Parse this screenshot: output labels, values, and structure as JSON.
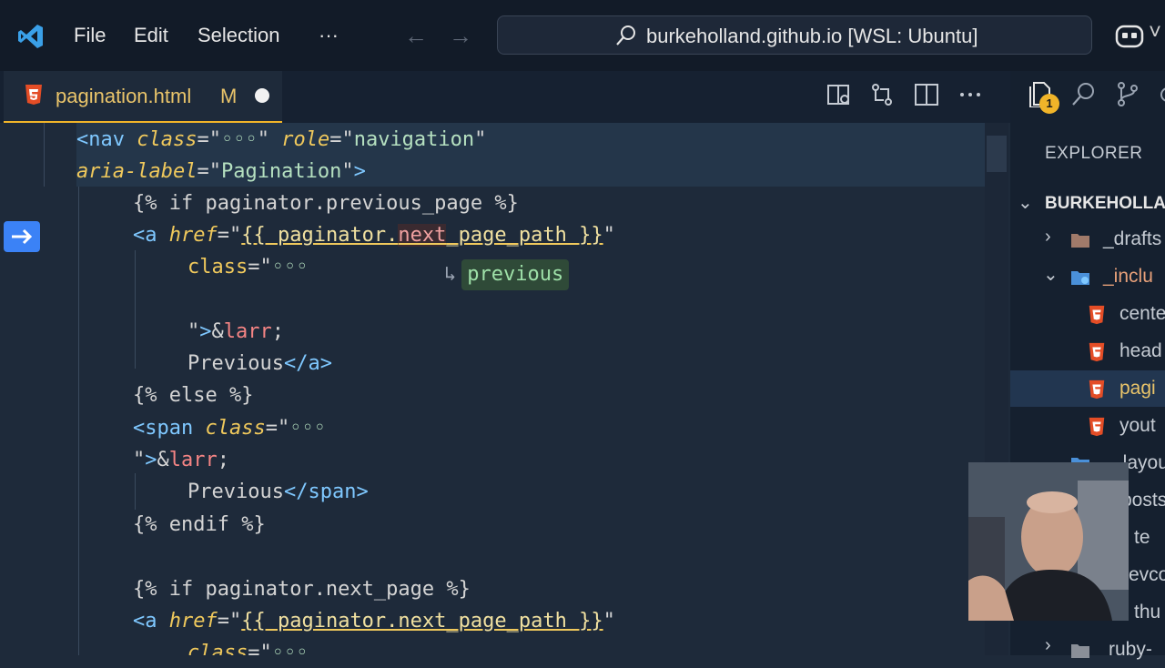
{
  "titlebar": {
    "menu": [
      "File",
      "Edit",
      "Selection",
      "···"
    ],
    "search_text": "burkeholland.github.io [WSL: Ubuntu]"
  },
  "tab": {
    "label": "pagination.html",
    "status": "M"
  },
  "editor": {
    "suggestion_arrow": "↳",
    "suggestion": "previous"
  },
  "sidebar": {
    "badge": "1",
    "explorer_title": "EXPLORER",
    "root": "BURKEHOLLA",
    "items": [
      {
        "label": "_drafts"
      },
      {
        "label": "_inclu"
      },
      {
        "label": "cente"
      },
      {
        "label": "head"
      },
      {
        "label": "pagi"
      },
      {
        "label": "yout"
      },
      {
        "label": "_layou"
      },
      {
        "label": "posts"
      },
      {
        "label": "te"
      },
      {
        "label": "evco"
      },
      {
        "label": "thu"
      },
      {
        "label": "ruby-"
      }
    ]
  },
  "colors": {
    "accent": "#f0b429",
    "background": "#1e2a3a",
    "gutter_arrow": "#3b82f6"
  }
}
